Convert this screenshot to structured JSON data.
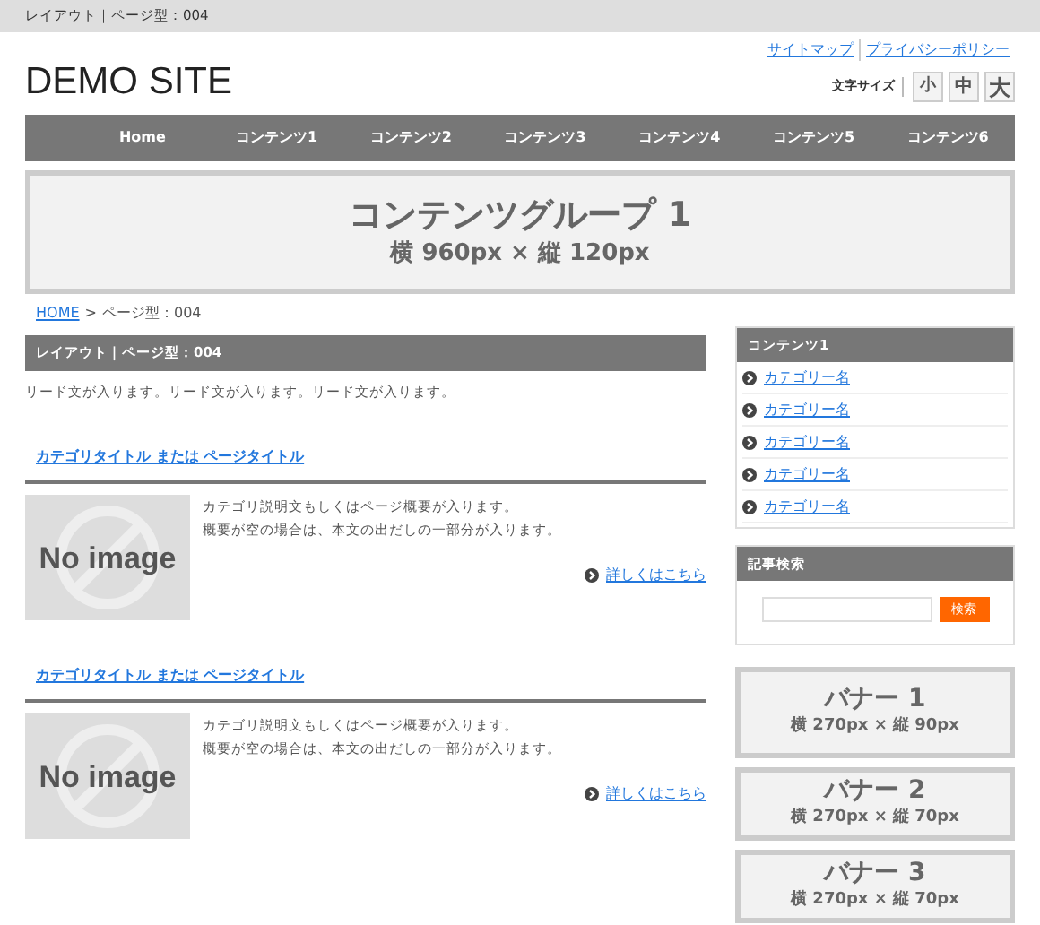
{
  "top_bar": {
    "text": "レイアウト｜ページ型：004"
  },
  "header": {
    "site_title": "DEMO SITE",
    "links": [
      "サイトマップ",
      "プライバシーポリシー"
    ],
    "font_size": {
      "label": "文字サイズ",
      "options": [
        {
          "label": "小",
          "kind": "small"
        },
        {
          "label": "中",
          "kind": "medium"
        },
        {
          "label": "大",
          "kind": "large"
        }
      ]
    }
  },
  "nav": [
    "Home",
    "コンテンツ1",
    "コンテンツ2",
    "コンテンツ3",
    "コンテンツ4",
    "コンテンツ5",
    "コンテンツ6"
  ],
  "hero": {
    "title": "コンテンツグループ 1",
    "subtitle": "横 960px × 縦 120px"
  },
  "breadcrumb": {
    "home": "HOME",
    "separator": ">",
    "current": "ページ型：004"
  },
  "main": {
    "heading": "レイアウト｜ページ型：004",
    "lead": "リード文が入ります。リード文が入ります。リード文が入ります。",
    "entries": [
      {
        "title": "カテゴリタイトル または ページタイトル",
        "image_text": "No image",
        "lines": [
          "カテゴリ説明文もしくはページ概要が入ります。",
          "概要が空の場合は、本文の出だしの一部分が入ります。"
        ],
        "more": "詳しくはこちら"
      },
      {
        "title": "カテゴリタイトル または ページタイトル",
        "image_text": "No image",
        "lines": [
          "カテゴリ説明文もしくはページ概要が入ります。",
          "概要が空の場合は、本文の出だしの一部分が入ります。"
        ],
        "more": "詳しくはこちら"
      }
    ]
  },
  "sidebar": {
    "menu": {
      "title": "コンテンツ1",
      "items": [
        "カテゴリー名",
        "カテゴリー名",
        "カテゴリー名",
        "カテゴリー名",
        "カテゴリー名"
      ]
    },
    "search": {
      "title": "記事検索",
      "button": "検索"
    },
    "banners": [
      {
        "title": "バナー 1",
        "size": "横 270px × 縦 90px",
        "kind": "tall"
      },
      {
        "title": "バナー 2",
        "size": "横 270px × 縦 70px",
        "kind": "short"
      },
      {
        "title": "バナー 3",
        "size": "横 270px × 縦 70px",
        "kind": "short"
      }
    ]
  }
}
